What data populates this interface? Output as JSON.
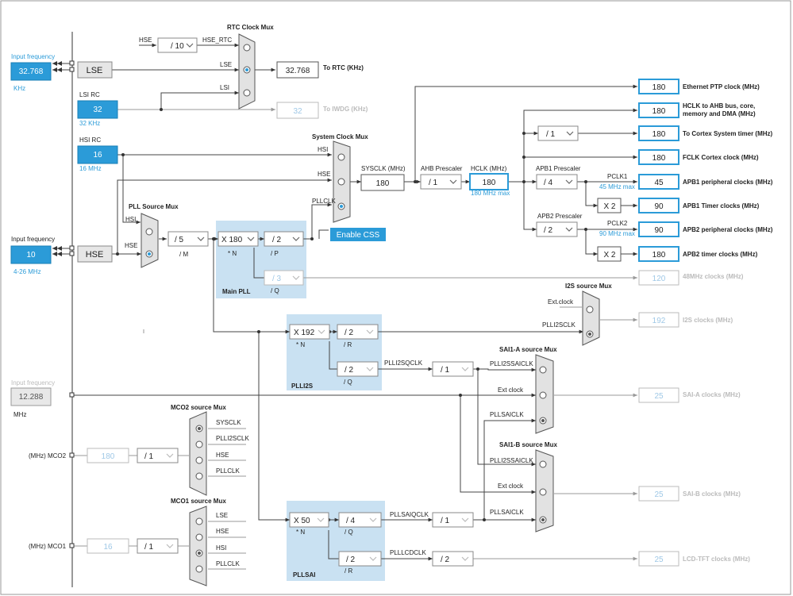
{
  "inputs": {
    "lse_freq": {
      "label": "Input frequency",
      "value": "32.768",
      "unit": "KHz"
    },
    "lsi": {
      "label": "LSI RC",
      "value": "32",
      "unit": "32 KHz"
    },
    "hsi": {
      "label": "HSI RC",
      "value": "16",
      "unit": "16 MHz"
    },
    "hse_freq": {
      "label": "Input frequency",
      "value": "10",
      "unit": "4-26 MHz"
    },
    "i2s_freq": {
      "label": "Input frequency",
      "value": "12.288",
      "unit": "MHz"
    }
  },
  "sources": {
    "lse": "LSE",
    "hse": "HSE"
  },
  "rtc": {
    "title": "RTC Clock Mux",
    "hse_label": "HSE",
    "hse_rtc_label": "HSE_RTC",
    "hse_div": "/ 10",
    "lse_label": "LSE",
    "lsi_label": "LSI",
    "to_rtc_value": "32.768",
    "to_rtc_label": "To RTC (KHz)",
    "to_iwdg_value": "32",
    "to_iwdg_label": "To IWDG (KHz)"
  },
  "sysmux": {
    "title": "System Clock Mux",
    "hsi": "HSI",
    "hse": "HSE",
    "pllclk": "PLLCLK",
    "enable_css": "Enable CSS",
    "sysclk_label": "SYSCLK (MHz)",
    "sysclk_value": "180",
    "ahb_label": "AHB Prescaler",
    "ahb_value": "/ 1",
    "hclk_label": "HCLK (MHz)",
    "hclk_value": "180",
    "hclk_max": "180 MHz max"
  },
  "apb": {
    "apb1_label": "APB1 Prescaler",
    "apb1_value": "/ 4",
    "pclk1": "PCLK1",
    "pclk1_max": "45 MHz max",
    "apb2_label": "APB2 Prescaler",
    "apb2_value": "/ 2",
    "pclk2": "PCLK2",
    "pclk2_max": "90 MHz max",
    "cortex_div": "/ 1",
    "x2a": "X 2",
    "x2b": "X 2"
  },
  "outputs": {
    "eth": {
      "value": "180",
      "label": "Ethernet PTP clock (MHz)"
    },
    "hclk": {
      "value": "180",
      "label1": "HCLK to AHB bus, core,",
      "label2": "memory and DMA (MHz)"
    },
    "cortex": {
      "value": "180",
      "label": "To Cortex System timer (MHz)"
    },
    "fclk": {
      "value": "180",
      "label": "FCLK Cortex clock (MHz)"
    },
    "apb1p": {
      "value": "45",
      "label": "APB1 peripheral clocks (MHz)"
    },
    "apb1t": {
      "value": "90",
      "label": "APB1 Timer clocks (MHz)"
    },
    "apb2p": {
      "value": "90",
      "label": "APB2 peripheral clocks (MHz)"
    },
    "apb2t": {
      "value": "180",
      "label": "APB2 timer clocks (MHz)"
    },
    "clk48": {
      "value": "120",
      "label": "48MHz clocks (MHz)"
    },
    "i2s": {
      "value": "192",
      "label": "I2S clocks (MHz)"
    },
    "saia": {
      "value": "25",
      "label": "SAI-A clocks (MHz)"
    },
    "saib": {
      "value": "25",
      "label": "SAI-B clocks (MHz)"
    },
    "lcd": {
      "value": "25",
      "label": "LCD-TFT clocks (MHz)"
    }
  },
  "pll": {
    "src_title": "PLL Source Mux",
    "hsi": "HSI",
    "hse": "HSE",
    "m_value": "/ 5",
    "m_label": "/ M",
    "n_value": "X 180",
    "n_label": "* N",
    "p_value": "/ 2",
    "p_label": "/ P",
    "q_value": "/ 3",
    "q_label": "/ Q",
    "title": "Main PLL"
  },
  "plli2s": {
    "n_value": "X 192",
    "n_label": "* N",
    "r_value": "/ 2",
    "r_label": "/ R",
    "q_value": "/ 2",
    "q_label": "/ Q",
    "title": "PLLI2S",
    "r_out": "PLLI2SCLK",
    "q_out": "PLLI2SQCLK",
    "q_div": "/ 1"
  },
  "i2smux": {
    "title": "I2S source Mux",
    "ext": "Ext.clock",
    "plli2sclk": "PLLI2SCLK"
  },
  "saia": {
    "title": "SAI1-A source Mux",
    "plli2s": "PLLI2SSAICLK",
    "ext": "Ext clock",
    "pllsai": "PLLSAICLK"
  },
  "saib": {
    "title": "SAI1-B source Mux",
    "plli2s": "PLLI2SSAICLK",
    "ext": "Ext clock",
    "pllsai": "PLLSAICLK"
  },
  "pllsai": {
    "n_value": "X 50",
    "n_label": "* N",
    "q_value": "/ 4",
    "q_label": "/ Q",
    "r_value": "/ 2",
    "r_label": "/ R",
    "title": "PLLSAI",
    "q_out": "PLLSAIQCLK",
    "q_div": "/ 1",
    "r_out": "PLLLCDCLK",
    "r_div": "/ 2"
  },
  "mco2": {
    "title": "MCO2 source Mux",
    "in1": "SYSCLK",
    "in2": "PLLI2SCLK",
    "in3": "HSE",
    "in4": "PLLCLK",
    "label": "(MHz) MCO2",
    "value": "180",
    "div": "/ 1"
  },
  "mco1": {
    "title": "MCO1 source Mux",
    "in1": "LSE",
    "in2": "HSE",
    "in3": "HSI",
    "in4": "PLLCLK",
    "label": "(MHz) MCO1",
    "value": "16",
    "div": "/ 1"
  },
  "colors": {
    "accent": "#2b9bd8",
    "pll_panel": "#c9e1f2",
    "line": "#444444",
    "disabled": "#bbbbbb"
  }
}
